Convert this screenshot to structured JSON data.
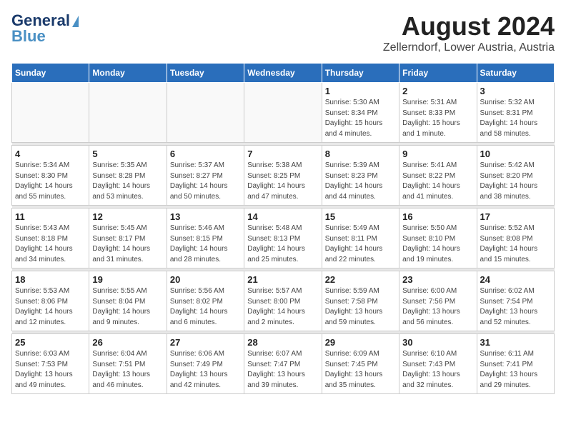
{
  "logo": {
    "line1": "General",
    "line2": "Blue"
  },
  "title": "August 2024",
  "subtitle": "Zellerndorf, Lower Austria, Austria",
  "days_of_week": [
    "Sunday",
    "Monday",
    "Tuesday",
    "Wednesday",
    "Thursday",
    "Friday",
    "Saturday"
  ],
  "weeks": [
    [
      {
        "day": "",
        "info": ""
      },
      {
        "day": "",
        "info": ""
      },
      {
        "day": "",
        "info": ""
      },
      {
        "day": "",
        "info": ""
      },
      {
        "day": "1",
        "info": "Sunrise: 5:30 AM\nSunset: 8:34 PM\nDaylight: 15 hours\nand 4 minutes."
      },
      {
        "day": "2",
        "info": "Sunrise: 5:31 AM\nSunset: 8:33 PM\nDaylight: 15 hours\nand 1 minute."
      },
      {
        "day": "3",
        "info": "Sunrise: 5:32 AM\nSunset: 8:31 PM\nDaylight: 14 hours\nand 58 minutes."
      }
    ],
    [
      {
        "day": "4",
        "info": "Sunrise: 5:34 AM\nSunset: 8:30 PM\nDaylight: 14 hours\nand 55 minutes."
      },
      {
        "day": "5",
        "info": "Sunrise: 5:35 AM\nSunset: 8:28 PM\nDaylight: 14 hours\nand 53 minutes."
      },
      {
        "day": "6",
        "info": "Sunrise: 5:37 AM\nSunset: 8:27 PM\nDaylight: 14 hours\nand 50 minutes."
      },
      {
        "day": "7",
        "info": "Sunrise: 5:38 AM\nSunset: 8:25 PM\nDaylight: 14 hours\nand 47 minutes."
      },
      {
        "day": "8",
        "info": "Sunrise: 5:39 AM\nSunset: 8:23 PM\nDaylight: 14 hours\nand 44 minutes."
      },
      {
        "day": "9",
        "info": "Sunrise: 5:41 AM\nSunset: 8:22 PM\nDaylight: 14 hours\nand 41 minutes."
      },
      {
        "day": "10",
        "info": "Sunrise: 5:42 AM\nSunset: 8:20 PM\nDaylight: 14 hours\nand 38 minutes."
      }
    ],
    [
      {
        "day": "11",
        "info": "Sunrise: 5:43 AM\nSunset: 8:18 PM\nDaylight: 14 hours\nand 34 minutes."
      },
      {
        "day": "12",
        "info": "Sunrise: 5:45 AM\nSunset: 8:17 PM\nDaylight: 14 hours\nand 31 minutes."
      },
      {
        "day": "13",
        "info": "Sunrise: 5:46 AM\nSunset: 8:15 PM\nDaylight: 14 hours\nand 28 minutes."
      },
      {
        "day": "14",
        "info": "Sunrise: 5:48 AM\nSunset: 8:13 PM\nDaylight: 14 hours\nand 25 minutes."
      },
      {
        "day": "15",
        "info": "Sunrise: 5:49 AM\nSunset: 8:11 PM\nDaylight: 14 hours\nand 22 minutes."
      },
      {
        "day": "16",
        "info": "Sunrise: 5:50 AM\nSunset: 8:10 PM\nDaylight: 14 hours\nand 19 minutes."
      },
      {
        "day": "17",
        "info": "Sunrise: 5:52 AM\nSunset: 8:08 PM\nDaylight: 14 hours\nand 15 minutes."
      }
    ],
    [
      {
        "day": "18",
        "info": "Sunrise: 5:53 AM\nSunset: 8:06 PM\nDaylight: 14 hours\nand 12 minutes."
      },
      {
        "day": "19",
        "info": "Sunrise: 5:55 AM\nSunset: 8:04 PM\nDaylight: 14 hours\nand 9 minutes."
      },
      {
        "day": "20",
        "info": "Sunrise: 5:56 AM\nSunset: 8:02 PM\nDaylight: 14 hours\nand 6 minutes."
      },
      {
        "day": "21",
        "info": "Sunrise: 5:57 AM\nSunset: 8:00 PM\nDaylight: 14 hours\nand 2 minutes."
      },
      {
        "day": "22",
        "info": "Sunrise: 5:59 AM\nSunset: 7:58 PM\nDaylight: 13 hours\nand 59 minutes."
      },
      {
        "day": "23",
        "info": "Sunrise: 6:00 AM\nSunset: 7:56 PM\nDaylight: 13 hours\nand 56 minutes."
      },
      {
        "day": "24",
        "info": "Sunrise: 6:02 AM\nSunset: 7:54 PM\nDaylight: 13 hours\nand 52 minutes."
      }
    ],
    [
      {
        "day": "25",
        "info": "Sunrise: 6:03 AM\nSunset: 7:53 PM\nDaylight: 13 hours\nand 49 minutes."
      },
      {
        "day": "26",
        "info": "Sunrise: 6:04 AM\nSunset: 7:51 PM\nDaylight: 13 hours\nand 46 minutes."
      },
      {
        "day": "27",
        "info": "Sunrise: 6:06 AM\nSunset: 7:49 PM\nDaylight: 13 hours\nand 42 minutes."
      },
      {
        "day": "28",
        "info": "Sunrise: 6:07 AM\nSunset: 7:47 PM\nDaylight: 13 hours\nand 39 minutes."
      },
      {
        "day": "29",
        "info": "Sunrise: 6:09 AM\nSunset: 7:45 PM\nDaylight: 13 hours\nand 35 minutes."
      },
      {
        "day": "30",
        "info": "Sunrise: 6:10 AM\nSunset: 7:43 PM\nDaylight: 13 hours\nand 32 minutes."
      },
      {
        "day": "31",
        "info": "Sunrise: 6:11 AM\nSunset: 7:41 PM\nDaylight: 13 hours\nand 29 minutes."
      }
    ]
  ]
}
